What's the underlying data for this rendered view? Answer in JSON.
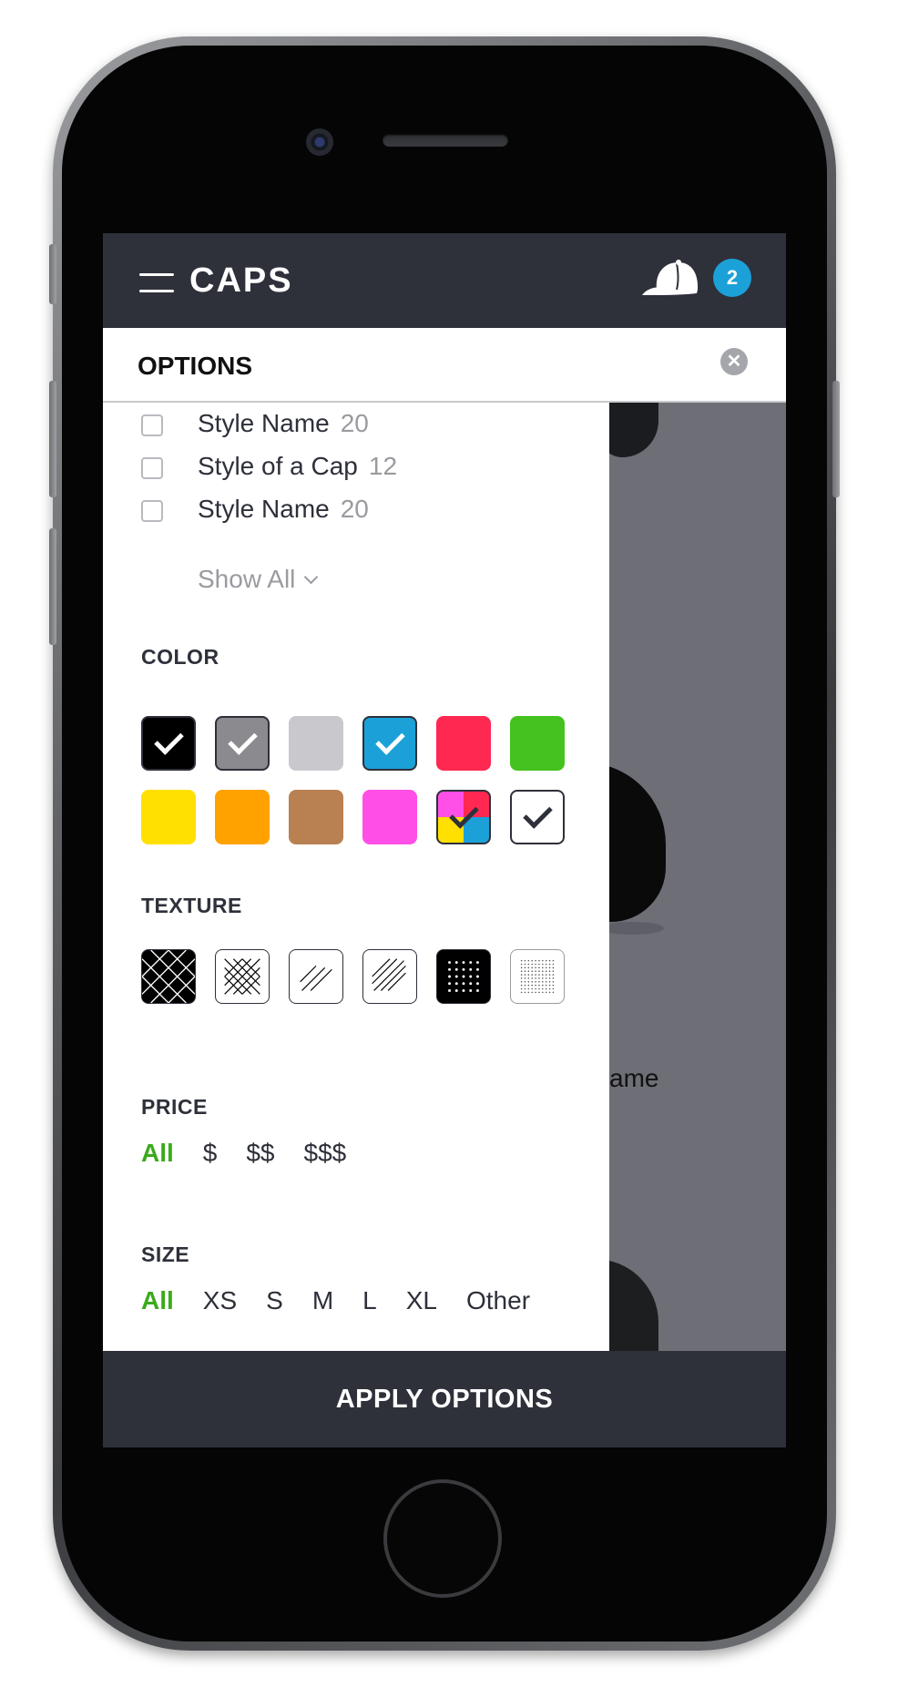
{
  "header": {
    "logo": "CAPS",
    "cart_count": "2"
  },
  "options": {
    "title": "OPTIONS",
    "style_items": [
      {
        "label": "Style Name",
        "count": "20"
      },
      {
        "label": "Style of a Cap",
        "count": "12"
      },
      {
        "label": "Style Name",
        "count": "20"
      }
    ],
    "show_all": "Show All",
    "color_title": "COLOR",
    "colors": [
      {
        "hex": "#000000",
        "checked": true
      },
      {
        "hex": "#8a8a8f",
        "checked": true
      },
      {
        "hex": "#c8c8cd",
        "checked": false
      },
      {
        "hex": "#1ba1d8",
        "checked": true
      },
      {
        "hex": "#fe2851",
        "checked": false
      },
      {
        "hex": "#44c21f",
        "checked": false
      },
      {
        "hex": "#ffe000",
        "checked": false
      },
      {
        "hex": "#ffa200",
        "checked": false
      },
      {
        "hex": "#b98051",
        "checked": false
      },
      {
        "hex": "#ff4fe6",
        "checked": false
      },
      {
        "hex": "multicolor",
        "checked": true
      },
      {
        "hex": "#ffffff",
        "checked": true
      }
    ],
    "texture_title": "TEXTURE",
    "textures": [
      "crosshatch-dark",
      "crosshatch-fine",
      "diagonal-wide",
      "diagonal-fine",
      "dots-dark",
      "dots-fine"
    ],
    "price_title": "PRICE",
    "price_options": [
      "All",
      "$",
      "$$",
      "$$$"
    ],
    "size_title": "SIZE",
    "size_options": [
      "All",
      "XS",
      "S",
      "M",
      "L",
      "XL",
      "Other"
    ]
  },
  "background": {
    "product_name_fragment": "ame"
  },
  "apply_label": "APPLY OPTIONS",
  "colors": {
    "bar": "#2e303a",
    "accent_active": "#3aab19",
    "badge": "#1ba1d8"
  }
}
